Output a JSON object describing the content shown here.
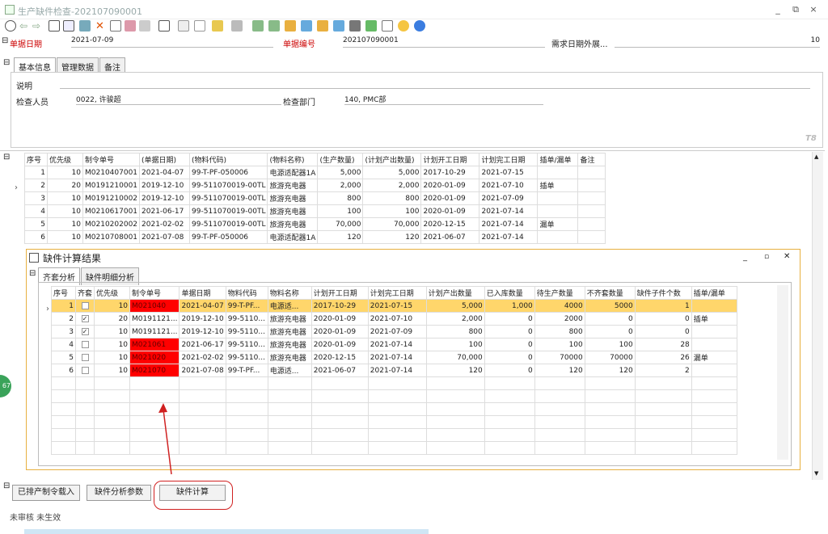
{
  "window": {
    "title": "生产缺件检查-202107090001",
    "min": "_",
    "max": "⧉",
    "close": "×"
  },
  "header": {
    "date_label": "单据日期",
    "date_value": "2021-07-09",
    "number_label": "单据编号",
    "number_value": "202107090001",
    "demand_label": "需求日期外展...",
    "demand_value": "10"
  },
  "tabs": [
    "基本信息",
    "管理数据",
    "备注"
  ],
  "info": {
    "desc_label": "说明",
    "inspector_label": "检查人员",
    "inspector_value": "0022, 许骏超",
    "dept_label": "检查部门",
    "dept_value": "140, PMC部",
    "tag": "T8"
  },
  "grid1": {
    "headers": [
      "序号",
      "优先级",
      "制令单号",
      "(单据日期)",
      "(物料代码)",
      "(物料名称)",
      "(生产数量)",
      "(计划产出数量)",
      "计划开工日期",
      "计划完工日期",
      "插单/漏单",
      "备注"
    ],
    "rows": [
      [
        "1",
        "10",
        "M0210407001",
        "2021-04-07",
        "99-T-PF-050006",
        "电源适配器1A",
        "5,000",
        "5,000",
        "2017-10-29",
        "2021-07-15",
        "",
        ""
      ],
      [
        "2",
        "20",
        "M0191210001",
        "2019-12-10",
        "99-511070019-00TL",
        "旅游充电器",
        "2,000",
        "2,000",
        "2020-01-09",
        "2021-07-10",
        "插单",
        ""
      ],
      [
        "3",
        "10",
        "M0191210002",
        "2019-12-10",
        "99-511070019-00TL",
        "旅游充电器",
        "800",
        "800",
        "2020-01-09",
        "2021-07-09",
        "",
        ""
      ],
      [
        "4",
        "10",
        "M0210617001",
        "2021-06-17",
        "99-511070019-00TL",
        "旅游充电器",
        "100",
        "100",
        "2020-01-09",
        "2021-07-14",
        "",
        ""
      ],
      [
        "5",
        "10",
        "M0210202002",
        "2021-02-02",
        "99-511070019-00TL",
        "旅游充电器",
        "70,000",
        "70,000",
        "2020-12-15",
        "2021-07-14",
        "漏单",
        ""
      ],
      [
        "6",
        "10",
        "M0210708001",
        "2021-07-08",
        "99-T-PF-050006",
        "电源适配器1A",
        "120",
        "120",
        "2021-06-07",
        "2021-07-14",
        "",
        ""
      ]
    ]
  },
  "popup": {
    "title": "缺件计算结果",
    "tabs": [
      "齐套分析",
      "缺件明细分析"
    ],
    "headers": [
      "序号",
      "齐套",
      "优先级",
      "制令单号",
      "单据日期",
      "物料代码",
      "物料名称",
      "计划开工日期",
      "计划完工日期",
      "计划产出数量",
      "已入库数量",
      "待生产数量",
      "不齐套数量",
      "缺件子件个数",
      "插单/漏单"
    ],
    "rows": [
      [
        "1",
        "",
        "10",
        "M021040",
        "2021-04-07",
        "99-T-PF...",
        "电源适...",
        "2017-10-29",
        "2021-07-15",
        "5,000",
        "1,000",
        "4000",
        "5000",
        "1",
        ""
      ],
      [
        "2",
        "✓",
        "20",
        "M0191121...",
        "2019-12-10",
        "99-5110...",
        "旅游充电器",
        "2020-01-09",
        "2021-07-10",
        "2,000",
        "0",
        "2000",
        "0",
        "0",
        "插单"
      ],
      [
        "3",
        "✓",
        "10",
        "M0191121...",
        "2019-12-10",
        "99-5110...",
        "旅游充电器",
        "2020-01-09",
        "2021-07-09",
        "800",
        "0",
        "800",
        "0",
        "0",
        ""
      ],
      [
        "4",
        "",
        "10",
        "M021061",
        "2021-06-17",
        "99-5110...",
        "旅游充电器",
        "2020-01-09",
        "2021-07-14",
        "100",
        "0",
        "100",
        "100",
        "28",
        ""
      ],
      [
        "5",
        "",
        "10",
        "M021020",
        "2021-02-02",
        "99-5110...",
        "旅游充电器",
        "2020-12-15",
        "2021-07-14",
        "70,000",
        "0",
        "70000",
        "70000",
        "26",
        "漏单"
      ],
      [
        "6",
        "",
        "10",
        "M021070",
        "2021-07-08",
        "99-T-PF...",
        "电源适...",
        "2021-06-07",
        "2021-07-14",
        "120",
        "0",
        "120",
        "120",
        "2",
        ""
      ]
    ]
  },
  "buttons": [
    "已排产制令载入",
    "缺件分析参数",
    "缺件计算"
  ],
  "status": "未审核 未生效",
  "side_badge": "67",
  "colors": {
    "highlight": "#ffd66b",
    "shortage": "#ff0000",
    "annotation": "#d02020",
    "popup_border": "#e8b040"
  }
}
